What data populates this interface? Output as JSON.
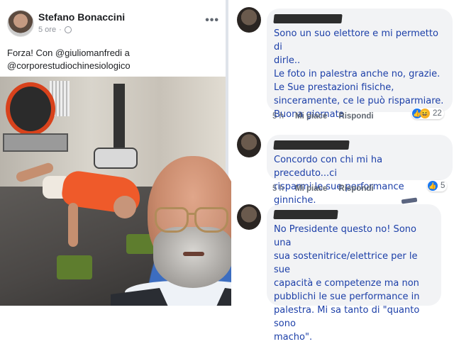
{
  "post": {
    "author": "Stefano Bonaccini",
    "time": "5 ore",
    "text": "Forza! Con @giuliomanfredi a\n@corporestudiochinesiologico",
    "more_icon": "more-options-icon",
    "privacy_icon": "globe-icon"
  },
  "comments": [
    {
      "text": "Sono un suo elettore e mi permetto di\ndirle..\nLe foto in palestra anche no, grazie.\nLe Sue prestazioni fisiche,\nsinceramente, ce le può risparmiare.\nBuona giornata",
      "time": "5 h",
      "like_label": "Mi piace",
      "reply_label": "Rispondi",
      "reactions": [
        "like",
        "haha"
      ],
      "reaction_count": "22"
    },
    {
      "text": "Concordo con chi mi ha preceduto...ci\nrisparmi le sue performance ginniche.",
      "time": "5 h",
      "like_label": "Mi piace",
      "reply_label": "Rispondi",
      "reactions": [
        "like"
      ],
      "reaction_count": "5"
    },
    {
      "text": "No Presidente questo no! Sono una\nsua sostenitrice/elettrice per le sue\ncapacità e competenze ma non\npubblichi le sue performance in\npalestra. Mi sa tanto di \"quanto sono\nmacho\".",
      "time": "",
      "like_label": "",
      "reply_label": "",
      "reactions": [],
      "reaction_count": ""
    }
  ],
  "colors": {
    "comment_text": "#1c3fa8",
    "bubble_bg": "#f2f3f5",
    "meta_text": "#606770",
    "like_blue": "#1877f2"
  }
}
